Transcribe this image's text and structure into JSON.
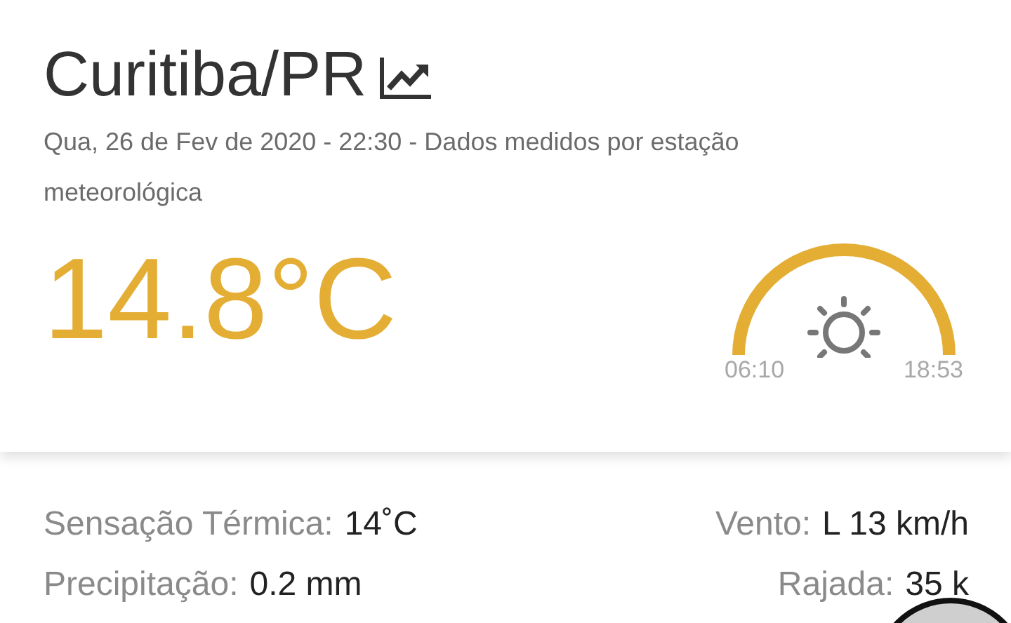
{
  "city": "Curitiba/PR",
  "subtitle": "Qua, 26 de Fev de 2020 - 22:30 - Dados medidos por estação meteorológica",
  "temperature": "14.8°C",
  "sunrise": "06:10",
  "sunset": "18:53",
  "details_left": [
    {
      "label": "Sensação Térmica:",
      "value": "14˚C"
    },
    {
      "label": "Precipitação:",
      "value": "0.2 mm"
    }
  ],
  "details_right": [
    {
      "label": "Vento:",
      "value": "L 13 km/h"
    },
    {
      "label": "Rajada:",
      "value": "35 k"
    }
  ]
}
